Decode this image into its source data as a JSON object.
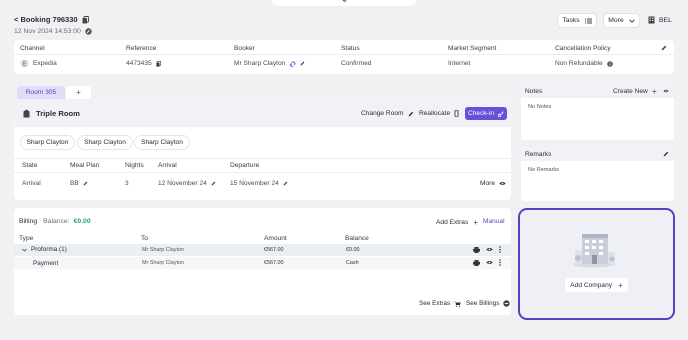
{
  "header": {
    "booking_title": "< Booking 796330",
    "booking_date": "12 Nov 2024 14:53:00",
    "tasks_label": "Tasks",
    "more_label": "More",
    "property_code": "BEL"
  },
  "summary": {
    "columns": [
      "Channel",
      "Reference",
      "Booker",
      "Status",
      "Market Segment",
      "Cancellation Policy"
    ],
    "channel": "Expedia",
    "reference": "4473435",
    "booker": "Mr Sharp Clayton",
    "status": "Confirmed",
    "market_segment": "Internet",
    "cancellation_policy": "Non Refundable"
  },
  "room": {
    "tab_label": "Room 305",
    "add_tab_label": "+",
    "room_type": "Triple Room",
    "change_room_label": "Change Room",
    "reallocate_label": "Reallocate",
    "checkin_label": "Check-in",
    "guests": [
      "Sharp Clayton",
      "Sharp Clayton",
      "Sharp Clayton"
    ],
    "table_headers": [
      "State",
      "Meal Plan",
      "Nights",
      "Arrival",
      "Departure"
    ],
    "state": "Arrival",
    "meal_plan": "BB",
    "nights": "3",
    "arrival": "12 November 24",
    "departure": "15 November 24",
    "more_label": "More"
  },
  "billing": {
    "title": "Billing",
    "balance_label": "Balance:",
    "balance_value": "€0.00",
    "add_extras_label": "Add Extras",
    "manual_label": "Manual",
    "headers": [
      "Type",
      "To",
      "Amount",
      "Balance"
    ],
    "rows": [
      {
        "type": "Proforma (1)",
        "to": "Mr Sharp Clayton",
        "amount": "€567.00",
        "balance": "€0.00"
      },
      {
        "type": "Payment",
        "to": "Mr Sharp Clayton",
        "amount": "€567.00",
        "balance": "Cash"
      }
    ],
    "see_extras_label": "See Extras",
    "see_billings_label": "See Billings"
  },
  "notes": {
    "title": "Notes",
    "create_new_label": "Create New",
    "placeholder": "No Notes"
  },
  "remarks": {
    "title": "Remarks",
    "placeholder": "No Remarks"
  },
  "company": {
    "add_company_label": "Add Company",
    "accent_color": "#5b3fc4"
  },
  "colors": {
    "accent": "#6a4fd8",
    "balance_green": "#1fa37a",
    "background": "#f1f1f4"
  }
}
